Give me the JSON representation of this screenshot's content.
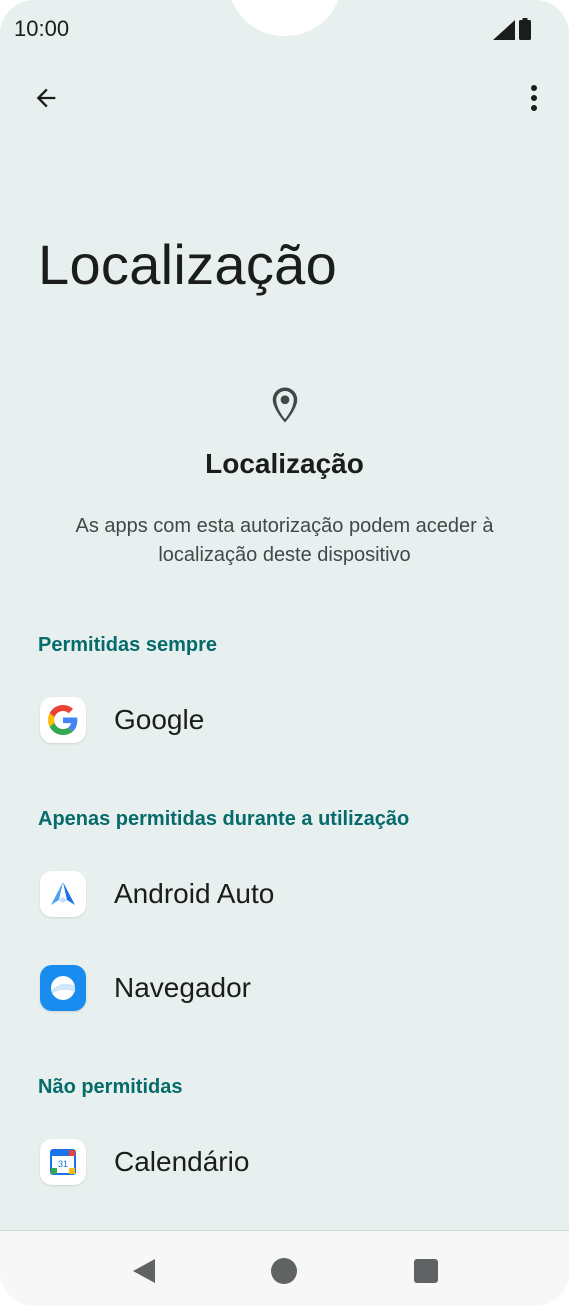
{
  "status_bar": {
    "time": "10:00",
    "signal_icon": "signal-icon",
    "battery_icon": "battery-icon"
  },
  "toolbar": {
    "back_icon": "back-arrow-icon",
    "more_icon": "more-vert-icon"
  },
  "page": {
    "title": "Localização"
  },
  "header": {
    "icon": "location-pin-icon",
    "title": "Localização",
    "description": "As apps com esta autorização podem aceder à localização deste dispositivo"
  },
  "sections": {
    "always": {
      "label": "Permitidas sempre",
      "apps": [
        {
          "name": "Google",
          "icon": "google-icon"
        }
      ]
    },
    "while_using": {
      "label": "Apenas permitidas durante a utilização",
      "apps": [
        {
          "name": "Android Auto",
          "icon": "android-auto-icon"
        },
        {
          "name": "Navegador",
          "icon": "browser-icon"
        }
      ]
    },
    "denied": {
      "label": "Não permitidas",
      "apps": [
        {
          "name": "Calendário",
          "icon": "calendar-icon"
        }
      ]
    }
  },
  "calendar_icon_day": "31",
  "colors": {
    "background": "#e8f0ef",
    "accent": "#066b6b",
    "text": "#1b1c1c"
  },
  "nav_bar": {
    "back": "nav-back-icon",
    "home": "nav-home-icon",
    "recents": "nav-recents-icon"
  }
}
